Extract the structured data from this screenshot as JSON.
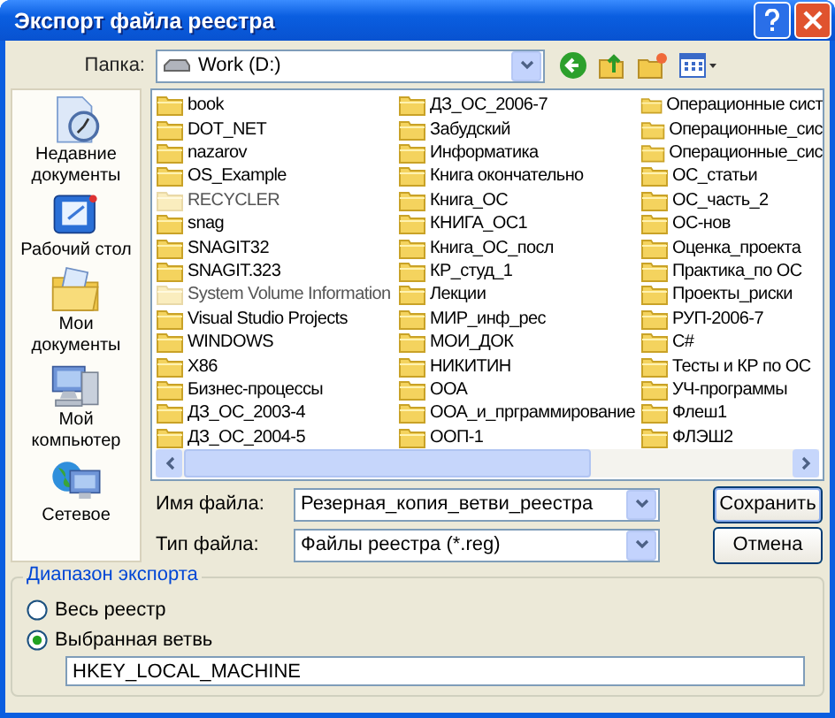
{
  "window": {
    "title": "Экспорт файла реестра"
  },
  "folder_bar": {
    "label": "Папка:",
    "value": "Work (D:)"
  },
  "places": [
    {
      "kind": "recent",
      "label": "Недавние документы"
    },
    {
      "kind": "desktop",
      "label": "Рабочий стол"
    },
    {
      "kind": "documents",
      "label": "Мои документы"
    },
    {
      "kind": "computer",
      "label": "Мой компьютер"
    },
    {
      "kind": "network",
      "label": "Сетевое"
    }
  ],
  "file_list": {
    "columns": [
      [
        {
          "name": "book",
          "hidden": false
        },
        {
          "name": "DOT_NET",
          "hidden": false
        },
        {
          "name": "nazarov",
          "hidden": false
        },
        {
          "name": "OS_Example",
          "hidden": false
        },
        {
          "name": "RECYCLER",
          "hidden": true
        },
        {
          "name": "snag",
          "hidden": false
        },
        {
          "name": "SNAGIT32",
          "hidden": false
        },
        {
          "name": "SNAGIT.323",
          "hidden": false
        },
        {
          "name": "System Volume Information",
          "hidden": true
        },
        {
          "name": "Visual Studio Projects",
          "hidden": false
        },
        {
          "name": "WINDOWS",
          "hidden": false
        },
        {
          "name": "X86",
          "hidden": false
        },
        {
          "name": "Бизнес-процессы",
          "hidden": false
        },
        {
          "name": "ДЗ_ОС_2003-4",
          "hidden": false
        },
        {
          "name": "ДЗ_ОС_2004-5",
          "hidden": false
        }
      ],
      [
        {
          "name": "ДЗ_ОС_2006-7",
          "hidden": false
        },
        {
          "name": "Забудский",
          "hidden": false
        },
        {
          "name": "Информатика",
          "hidden": false
        },
        {
          "name": "Книга окончательно",
          "hidden": false
        },
        {
          "name": "Книга_ОС",
          "hidden": false
        },
        {
          "name": "КНИГА_ОС1",
          "hidden": false
        },
        {
          "name": "Книга_ОС_посл",
          "hidden": false
        },
        {
          "name": "КР_студ_1",
          "hidden": false
        },
        {
          "name": "Лекции",
          "hidden": false
        },
        {
          "name": "МИР_инф_рес",
          "hidden": false
        },
        {
          "name": "МОИ_ДОК",
          "hidden": false
        },
        {
          "name": "НИКИТИН",
          "hidden": false
        },
        {
          "name": "ООА",
          "hidden": false
        },
        {
          "name": "ООА_и_прграммирование",
          "hidden": false
        },
        {
          "name": "ООП-1",
          "hidden": false
        }
      ],
      [
        {
          "name": "Операционные сист",
          "hidden": false
        },
        {
          "name": "Операционные_сис",
          "hidden": false
        },
        {
          "name": "Операционные_сис",
          "hidden": false
        },
        {
          "name": "ОС_статьи",
          "hidden": false
        },
        {
          "name": "ОС_часть_2",
          "hidden": false
        },
        {
          "name": "ОС-нов",
          "hidden": false
        },
        {
          "name": "Оценка_проекта",
          "hidden": false
        },
        {
          "name": "Практика_по ОС",
          "hidden": false
        },
        {
          "name": "Проекты_риски",
          "hidden": false
        },
        {
          "name": "РУП-2006-7",
          "hidden": false
        },
        {
          "name": "C#",
          "hidden": false
        },
        {
          "name": "Тесты и КР по ОС",
          "hidden": false
        },
        {
          "name": "УЧ-программы",
          "hidden": false
        },
        {
          "name": "Флеш1",
          "hidden": false
        },
        {
          "name": "ФЛЭШ2",
          "hidden": false
        }
      ]
    ]
  },
  "file_name": {
    "label": "Имя файла:",
    "value": "Резерная_копия_ветви_реестра"
  },
  "file_type": {
    "label": "Тип файла:",
    "value": "Файлы реестра (*.reg)"
  },
  "buttons": [
    "Сохранить",
    "Отмена"
  ],
  "export_range": {
    "title": "Диапазон экспорта",
    "options": [
      {
        "label": "Весь реестр",
        "selected": false
      },
      {
        "label": "Выбранная ветвь",
        "selected": true
      }
    ],
    "branch": "HKEY_LOCAL_MACHINE"
  }
}
